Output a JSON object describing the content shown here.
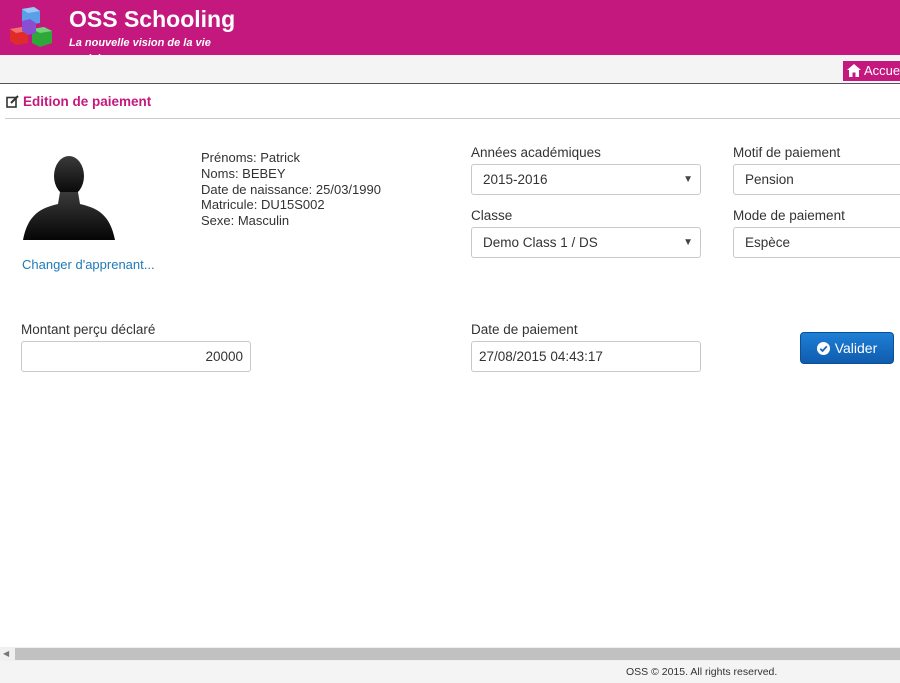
{
  "header": {
    "title": "OSS Schooling",
    "subtitle": "La nouvelle vision de la vie scolaire"
  },
  "navbar": {
    "home_label": "Accueil"
  },
  "section": {
    "title": "Edition de paiement"
  },
  "student": {
    "change_link": "Changer d'apprenant...",
    "prenoms": "Prénoms: Patrick",
    "noms": "Noms: BEBEY",
    "naissance": "Date de naissance: 25/03/1990",
    "matricule": "Matricule: DU15S002",
    "sexe": "Sexe: Masculin"
  },
  "form": {
    "annees_label": "Années académiques",
    "annees_value": "2015-2016",
    "classe_label": "Classe",
    "classe_value": "Demo Class 1 / DS",
    "motif_label": "Motif de paiement",
    "motif_value": "Pension",
    "mode_label": "Mode de paiement",
    "mode_value": "Espèce",
    "montant_label": "Montant perçu déclaré",
    "montant_value": "20000",
    "date_label": "Date de paiement",
    "date_value": "27/08/2015 04:43:17",
    "submit_label": "Valider"
  },
  "footer": {
    "text": "OSS © 2015. All rights reserved."
  },
  "colors": {
    "brand": "#c4187f",
    "link": "#1e7ab8",
    "button": "#1566c0"
  },
  "icons": [
    "logo-cubes-icon",
    "home-icon",
    "edit-icon",
    "user-silhouette-icon",
    "check-circle-icon",
    "caret-down-icon"
  ]
}
